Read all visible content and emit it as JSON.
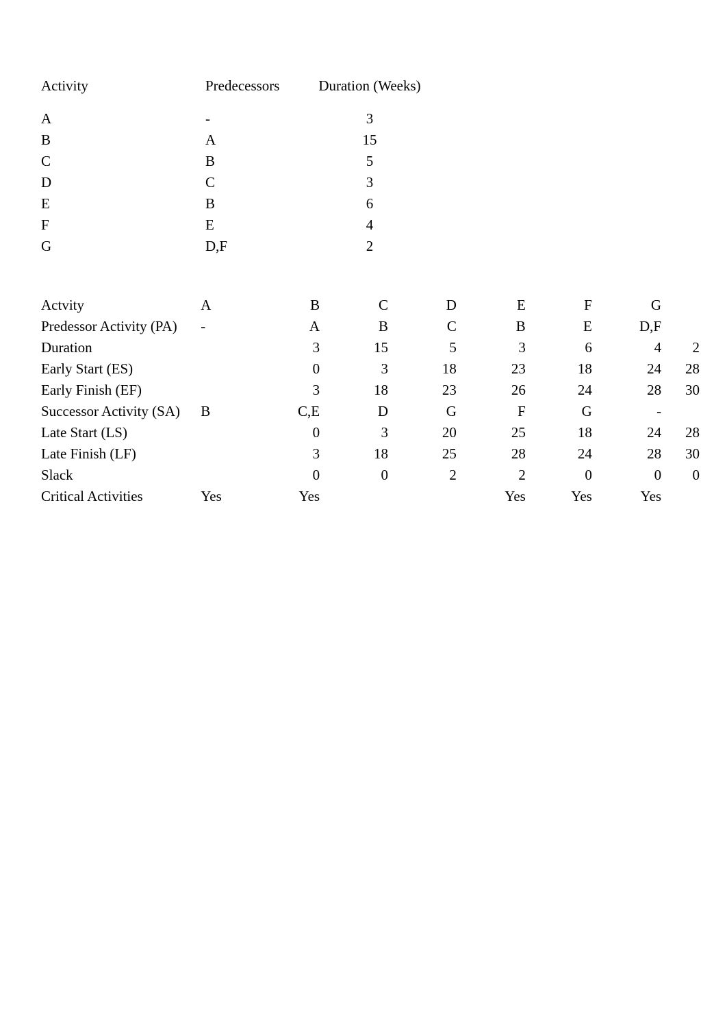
{
  "table1": {
    "headers": {
      "activity": "Activity",
      "predecessors": "Predecessors",
      "duration": "Duration (Weeks)"
    },
    "rows": [
      {
        "activity": "A",
        "predecessors": "-",
        "duration": "3"
      },
      {
        "activity": "B",
        "predecessors": "A",
        "duration": "15"
      },
      {
        "activity": "C",
        "predecessors": "B",
        "duration": "5"
      },
      {
        "activity": "D",
        "predecessors": "C",
        "duration": "3"
      },
      {
        "activity": "E",
        "predecessors": "B",
        "duration": "6"
      },
      {
        "activity": "F",
        "predecessors": "E",
        "duration": "4"
      },
      {
        "activity": "G",
        "predecessors": "D,F",
        "duration": "2"
      }
    ]
  },
  "table2": {
    "rows": [
      {
        "label": "Actvity",
        "A": "A",
        "B": "B",
        "C": "C",
        "D": "D",
        "E": "E",
        "F": "F",
        "G": "G",
        "H": ""
      },
      {
        "label": "Predessor Activity (PA)",
        "A": "-",
        "B": "A",
        "C": "B",
        "D": "C",
        "E": "B",
        "F": "E",
        "G": "D,F",
        "H": ""
      },
      {
        "label": "Duration",
        "A": "",
        "B": "3",
        "C": "15",
        "D": "5",
        "E": "3",
        "F": "6",
        "G": "4",
        "H": "2"
      },
      {
        "label": "Early Start (ES)",
        "A": "",
        "B": "0",
        "C": "3",
        "D": "18",
        "E": "23",
        "F": "18",
        "G": "24",
        "H": "28"
      },
      {
        "label": "Early Finish (EF)",
        "A": "",
        "B": "3",
        "C": "18",
        "D": "23",
        "E": "26",
        "F": "24",
        "G": "28",
        "H": "30"
      },
      {
        "label": "Successor Activity (SA)",
        "A": "B",
        "B": "C,E",
        "C": "D",
        "D": "G",
        "E": "F",
        "F": "G",
        "G": "-",
        "H": ""
      },
      {
        "label": "Late Start (LS)",
        "A": "",
        "B": "0",
        "C": "3",
        "D": "20",
        "E": "25",
        "F": "18",
        "G": "24",
        "H": "28"
      },
      {
        "label": "Late Finish (LF)",
        "A": "",
        "B": "3",
        "C": "18",
        "D": "25",
        "E": "28",
        "F": "24",
        "G": "28",
        "H": "30"
      },
      {
        "label": "Slack",
        "A": "",
        "B": "0",
        "C": "0",
        "D": "2",
        "E": "2",
        "F": "0",
        "G": "0",
        "H": "0"
      },
      {
        "label": "Critical Activities",
        "A": "Yes",
        "B": "Yes",
        "C": "",
        "D": "",
        "E": "Yes",
        "F": "Yes",
        "G": "Yes",
        "H": ""
      }
    ]
  }
}
